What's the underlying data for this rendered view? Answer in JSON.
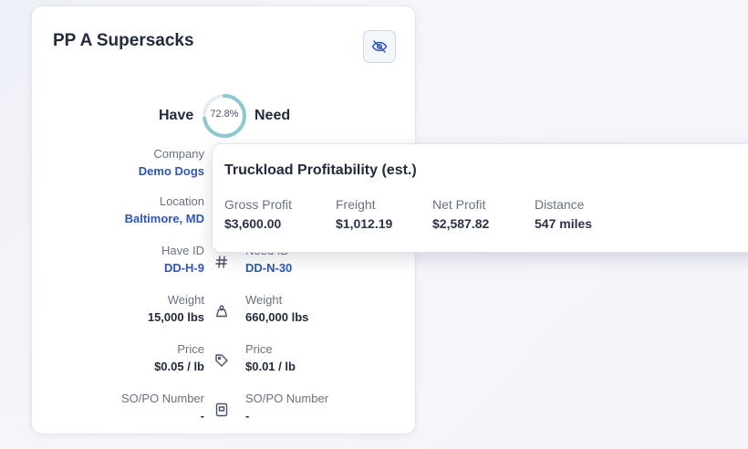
{
  "card": {
    "title": "PP A Supersacks",
    "have_label": "Have",
    "need_label": "Need",
    "fill_percent_text": "72.8%",
    "fill_fraction": 0.728,
    "accent_color": "#8ec9d0",
    "fields": {
      "company": {
        "label": "Company",
        "value": "Demo Dogs"
      },
      "location": {
        "label": "Location",
        "value": "Baltimore, MD"
      },
      "have_id": {
        "label": "Have ID",
        "value": "DD-H-9"
      },
      "need_id": {
        "label": "Need ID",
        "value": "DD-N-30"
      },
      "have_weight": {
        "label": "Weight",
        "value": "15,000 lbs"
      },
      "need_weight": {
        "label": "Weight",
        "value": "660,000 lbs"
      },
      "have_price": {
        "label": "Price",
        "value": "$0.05 / lb"
      },
      "need_price": {
        "label": "Price",
        "value": "$0.01 / lb"
      },
      "have_sopo": {
        "label": "SO/PO Number",
        "value": "-"
      },
      "need_sopo": {
        "label": "SO/PO Number",
        "value": "-"
      }
    },
    "icons": {
      "hide": "eye-off-icon",
      "id": "hash-icon",
      "weight": "weight-icon",
      "price": "tag-icon",
      "sopo": "document-icon"
    }
  },
  "popover": {
    "title": "Truckload Profitability (est.)",
    "metrics": [
      {
        "label": "Gross Profit",
        "value": "$3,600.00"
      },
      {
        "label": "Freight",
        "value": "$1,012.19"
      },
      {
        "label": "Net Profit",
        "value": "$2,587.82"
      },
      {
        "label": "Distance",
        "value": "547 miles"
      }
    ]
  }
}
